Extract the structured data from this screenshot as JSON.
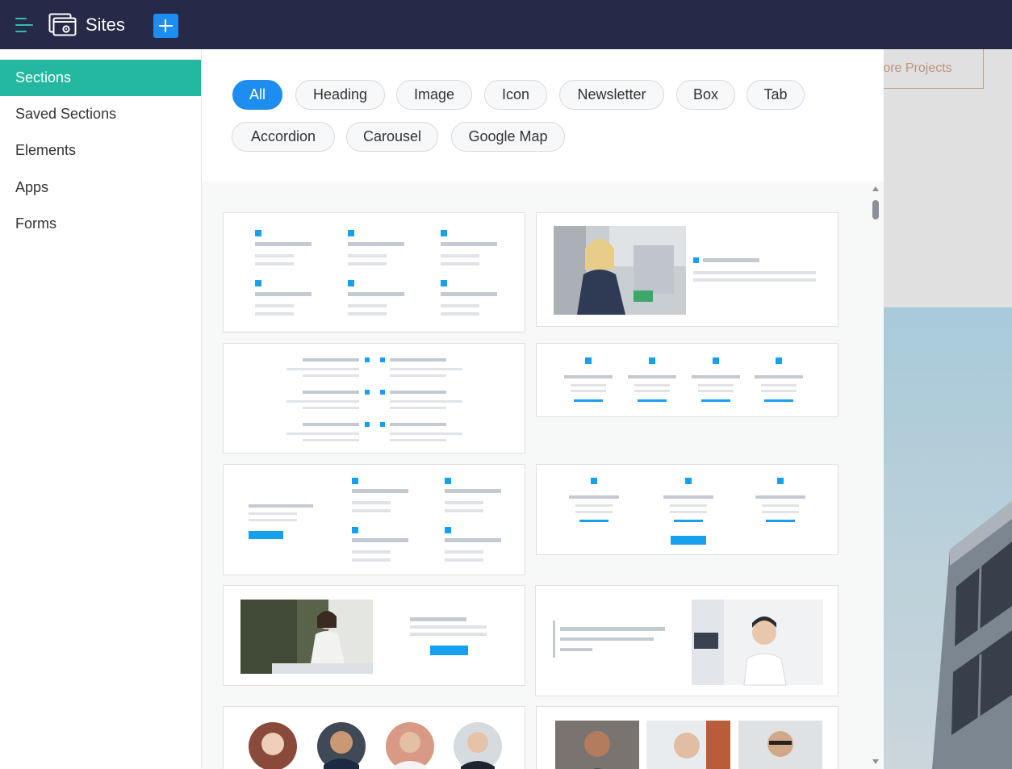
{
  "topbar": {
    "title": "Sites",
    "menu_icon": "hamburger-icon",
    "logo_icon": "sites-logo-icon",
    "add_icon": "plus-icon",
    "background": "#262a48",
    "accent": "#1e8df0"
  },
  "sidebar": {
    "items": [
      {
        "label": "Sections",
        "active": true
      },
      {
        "label": "Saved Sections",
        "active": false
      },
      {
        "label": "Elements",
        "active": false
      },
      {
        "label": "Apps",
        "active": false
      },
      {
        "label": "Forms",
        "active": false
      }
    ],
    "active_color": "#25b8a1"
  },
  "filters": {
    "chips": [
      "All",
      "Heading",
      "Image",
      "Icon",
      "Newsletter",
      "Box",
      "Tab",
      "Accordion",
      "Carousel",
      "Google Map"
    ],
    "selected": "All"
  },
  "gallery": {
    "templates": [
      "features-grid-6",
      "image-with-text",
      "center-icon-list",
      "features-4-columns",
      "text-cta-with-features",
      "features-3-columns-cta",
      "photo-with-cta",
      "text-with-photo",
      "team-avatars",
      "team-photos"
    ],
    "placeholder_blue": "#18a0f0",
    "placeholder_gray": "#c9ced6"
  },
  "preview": {
    "button_label": "ore Projects"
  }
}
